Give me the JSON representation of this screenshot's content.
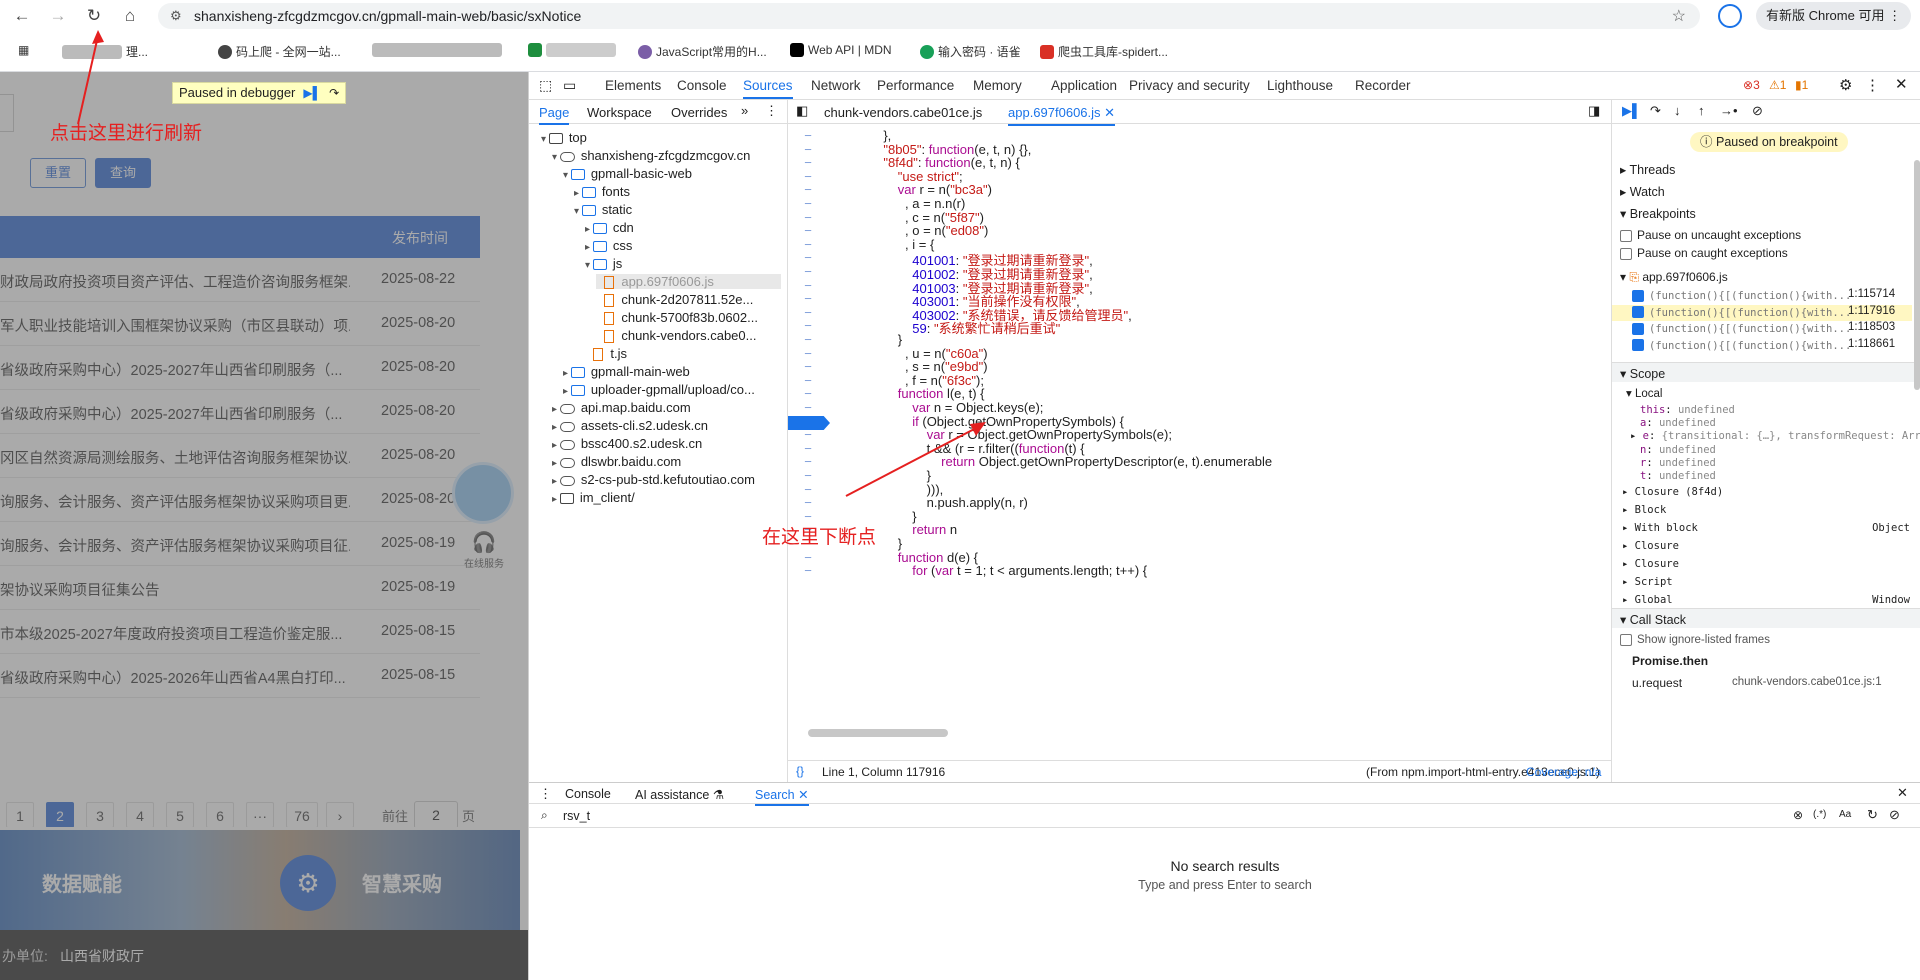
{
  "browser": {
    "url": "shanxisheng-zfcgdzmcgov.cn/gpmall-main-web/basic/sxNotice",
    "update_label": "有新版 Chrome 可用",
    "bookmarks": [
      "理...",
      "码上爬 - 全网一站...",
      "JavaScript常用的H...",
      "Web API | MDN",
      "输入密码 · 语雀",
      "爬虫工具库-spidert..."
    ]
  },
  "webpage": {
    "paused_label": "Paused in debugger",
    "annotation_refresh": "点击这里进行刷新",
    "reset_btn": "重置",
    "query_btn": "查询",
    "col_date": "发布时间",
    "rows": [
      {
        "title": "财政局政府投资项目资产评估、工程造价咨询服务框架...",
        "date": "2025-08-22"
      },
      {
        "title": "军人职业技能培训入围框架协议采购（市区县联动）项...",
        "date": "2025-08-20"
      },
      {
        "title": "省级政府采购中心）2025-2027年山西省印刷服务（...",
        "date": "2025-08-20"
      },
      {
        "title": "省级政府采购中心）2025-2027年山西省印刷服务（...",
        "date": "2025-08-20"
      },
      {
        "title": "冈区自然资源局测绘服务、土地评估咨询服务框架协议...",
        "date": "2025-08-20"
      },
      {
        "title": "询服务、会计服务、资产评估服务框架协议采购项目更...",
        "date": "2025-08-20"
      },
      {
        "title": "询服务、会计服务、资产评估服务框架协议采购项目征...",
        "date": "2025-08-19"
      },
      {
        "title": "架协议采购项目征集公告",
        "date": "2025-08-19"
      },
      {
        "title": "市本级2025-2027年度政府投资项目工程造价鉴定服...",
        "date": "2025-08-15"
      },
      {
        "title": "省级政府采购中心）2025-2026年山西省A4黑白打印...",
        "date": "2025-08-15"
      }
    ],
    "pages": [
      "1",
      "2",
      "3",
      "4",
      "5",
      "6",
      "···",
      "76"
    ],
    "goto_prefix": "前往",
    "goto_value": "2",
    "goto_suffix": "页",
    "online_service": "在线服务",
    "banner_left": "数据赋能",
    "banner_right": "智慧采购",
    "footer_label": "办单位:",
    "footer_value": "山西省财政厅"
  },
  "devtools": {
    "tabs": [
      "Elements",
      "Console",
      "Sources",
      "Network",
      "Performance",
      "Memory",
      "Application",
      "Privacy and security",
      "Lighthouse",
      "Recorder"
    ],
    "errors": "3",
    "warnings": "1",
    "issues": "1",
    "nav_tabs": [
      "Page",
      "Workspace",
      "Overrides"
    ],
    "file_tabs": [
      "chunk-vendors.cabe01ce.js",
      "app.697f0606.js"
    ],
    "tree": [
      {
        "label": "top",
        "type": "frame",
        "indent": 0
      },
      {
        "label": "shanxisheng-zfcgdzmcgov.cn",
        "type": "cloud",
        "indent": 1
      },
      {
        "label": "gpmall-basic-web",
        "type": "folder",
        "indent": 2
      },
      {
        "label": "fonts",
        "type": "folder",
        "indent": 3
      },
      {
        "label": "static",
        "type": "folder",
        "indent": 3
      },
      {
        "label": "cdn",
        "type": "folder",
        "indent": 4
      },
      {
        "label": "css",
        "type": "folder",
        "indent": 4
      },
      {
        "label": "js",
        "type": "folder",
        "indent": 4
      },
      {
        "label": "app.697f0606.js",
        "type": "file",
        "indent": 5
      },
      {
        "label": "chunk-2d207811.52e...",
        "type": "file",
        "indent": 5
      },
      {
        "label": "chunk-5700f83b.0602...",
        "type": "file",
        "indent": 5
      },
      {
        "label": "chunk-vendors.cabe0...",
        "type": "file",
        "indent": 5
      },
      {
        "label": "t.js",
        "type": "file",
        "indent": 4
      },
      {
        "label": "gpmall-main-web",
        "type": "folder",
        "indent": 2
      },
      {
        "label": "uploader-gpmall/upload/co...",
        "type": "folder",
        "indent": 2
      },
      {
        "label": "api.map.baidu.com",
        "type": "cloud",
        "indent": 1
      },
      {
        "label": "assets-cli.s2.udesk.cn",
        "type": "cloud",
        "indent": 1
      },
      {
        "label": "bssc400.s2.udesk.cn",
        "type": "cloud",
        "indent": 1
      },
      {
        "label": "dlswbr.baidu.com",
        "type": "cloud",
        "indent": 1
      },
      {
        "label": "s2-cs-pub-std.kefutoutiao.com",
        "type": "cloud",
        "indent": 1
      },
      {
        "label": "im_client/",
        "type": "frame",
        "indent": 1
      }
    ],
    "code_lines": [
      "            },",
      "            \"8b05\": function(e, t, n) {},",
      "            \"8f4d\": function(e, t, n) {",
      "                \"use strict\";",
      "                var r = n(\"bc3a\")",
      "                  , a = n.n(r)",
      "                  , c = n(\"5f87\")",
      "                  , o = n(\"ed08\")",
      "                  , i = {",
      "                    401001: \"登录过期请重新登录\",",
      "                    401002: \"登录过期请重新登录\",",
      "                    401003: \"登录过期请重新登录\",",
      "                    403001: \"当前操作没有权限\",",
      "                    403002: \"系统错误，请反馈给管理员\",",
      "                    59: \"系统繁忙请稍后重试\"",
      "                }",
      "                  , u = n(\"c60a\")",
      "                  , s = n(\"e9bd\")",
      "                  , f = n(\"6f3c\");",
      "                function l(e, t) {",
      "                    var n = Object.keys(e);",
      "                    if (Object.getOwnPropertySymbols) {",
      "                        var r = Object.getOwnPropertySymbols(e);",
      "                        t && (r = r.filter((function(t) {",
      "                            return Object.getOwnPropertyDescriptor(e, t).enumerable",
      "                        }",
      "                        ))),",
      "                        n.push.apply(n, r)",
      "                    }",
      "                    return n",
      "                }",
      "                function d(e) {",
      "                    for (var t = 1; t < arguments.length; t++) {"
    ],
    "status_pos": "Line 1, Column 117916",
    "status_from": "(From npm.import-html-entry.e413ece0.js:1)",
    "status_coverage": "Coverage: n/a",
    "annotation_breakpoint": "在这里下断点",
    "paused_banner": "Paused on breakpoint",
    "threads": "Threads",
    "watch": "Watch",
    "breakpoints": "Breakpoints",
    "pause_uncaught": "Pause on uncaught exceptions",
    "pause_caught": "Pause on caught exceptions",
    "bp_file": "app.697f0606.js",
    "bp_list": [
      {
        "code": "(function(){[(function(){with...",
        "loc": "1:115714"
      },
      {
        "code": "(function(){[(function(){with...",
        "loc": "1:117916"
      },
      {
        "code": "(function(){[(function(){with...",
        "loc": "1:118503"
      },
      {
        "code": "(function(){[(function(){with...",
        "loc": "1:118661"
      }
    ],
    "scope": "Scope",
    "local": "Local",
    "scope_vars": [
      {
        "k": "this",
        "v": "undefined"
      },
      {
        "k": "a",
        "v": "undefined"
      },
      {
        "k": "e",
        "v": "{transitional: {…}, transformRequest: Arr"
      },
      {
        "k": "n",
        "v": "undefined"
      },
      {
        "k": "r",
        "v": "undefined"
      },
      {
        "k": "t",
        "v": "undefined"
      }
    ],
    "scope_groups": [
      {
        "label": "Closure (8f4d)",
        "extra": ""
      },
      {
        "label": "Block",
        "extra": ""
      },
      {
        "label": "With block",
        "extra": "Object"
      },
      {
        "label": "Closure",
        "extra": ""
      },
      {
        "label": "Closure",
        "extra": ""
      },
      {
        "label": "Script",
        "extra": ""
      },
      {
        "label": "Global",
        "extra": "Window"
      }
    ],
    "call_stack": "Call Stack",
    "show_ignore": "Show ignore-listed frames",
    "promise_then": "Promise.then",
    "frame_fn": "u.request",
    "frame_loc": "chunk-vendors.cabe01ce.js:1",
    "drawer_tabs": [
      "Console",
      "AI assistance",
      "Search"
    ],
    "search_query": "rsv_t",
    "no_results": "No search results",
    "no_results_hint": "Type and press Enter to search"
  }
}
